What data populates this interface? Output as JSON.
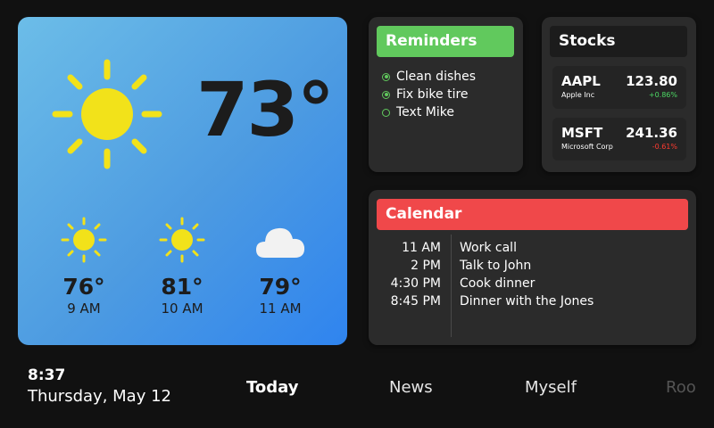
{
  "weather": {
    "current_temp": "73°",
    "current_icon": "sun-icon",
    "hourly": [
      {
        "temp": "76°",
        "label": "9 AM",
        "icon": "sun-icon"
      },
      {
        "temp": "81°",
        "label": "10 AM",
        "icon": "sun-icon"
      },
      {
        "temp": "79°",
        "label": "11 AM",
        "icon": "cloud-icon"
      }
    ]
  },
  "reminders": {
    "title": "Reminders",
    "items": [
      {
        "text": "Clean dishes",
        "done": true
      },
      {
        "text": "Fix bike tire",
        "done": true
      },
      {
        "text": "Text Mike",
        "done": false
      }
    ]
  },
  "stocks": {
    "title": "Stocks",
    "items": [
      {
        "symbol": "AAPL",
        "name": "Apple Inc",
        "price": "123.80",
        "change": "+0.86%",
        "direction": "up"
      },
      {
        "symbol": "MSFT",
        "name": "Microsoft Corp",
        "price": "241.36",
        "change": "-0.61%",
        "direction": "down"
      }
    ]
  },
  "calendar": {
    "title": "Calendar",
    "events": [
      {
        "time": "11 AM",
        "title": "Work call"
      },
      {
        "time": "2 PM",
        "title": "Talk to John"
      },
      {
        "time": "4:30 PM",
        "title": "Cook dinner"
      },
      {
        "time": "8:45 PM",
        "title": "Dinner with the Jones"
      }
    ]
  },
  "footer": {
    "time": "8:37",
    "date": "Thursday, May 12",
    "tabs": [
      "Today",
      "News",
      "Myself",
      "Roo"
    ],
    "active_tab": "Today"
  },
  "colors": {
    "reminders_accent": "#61c95d",
    "calendar_accent": "#f0484a",
    "stock_up": "#4cd964",
    "stock_down": "#ff3b30",
    "sun": "#f2e21a",
    "cloud": "#f2f2f2"
  }
}
